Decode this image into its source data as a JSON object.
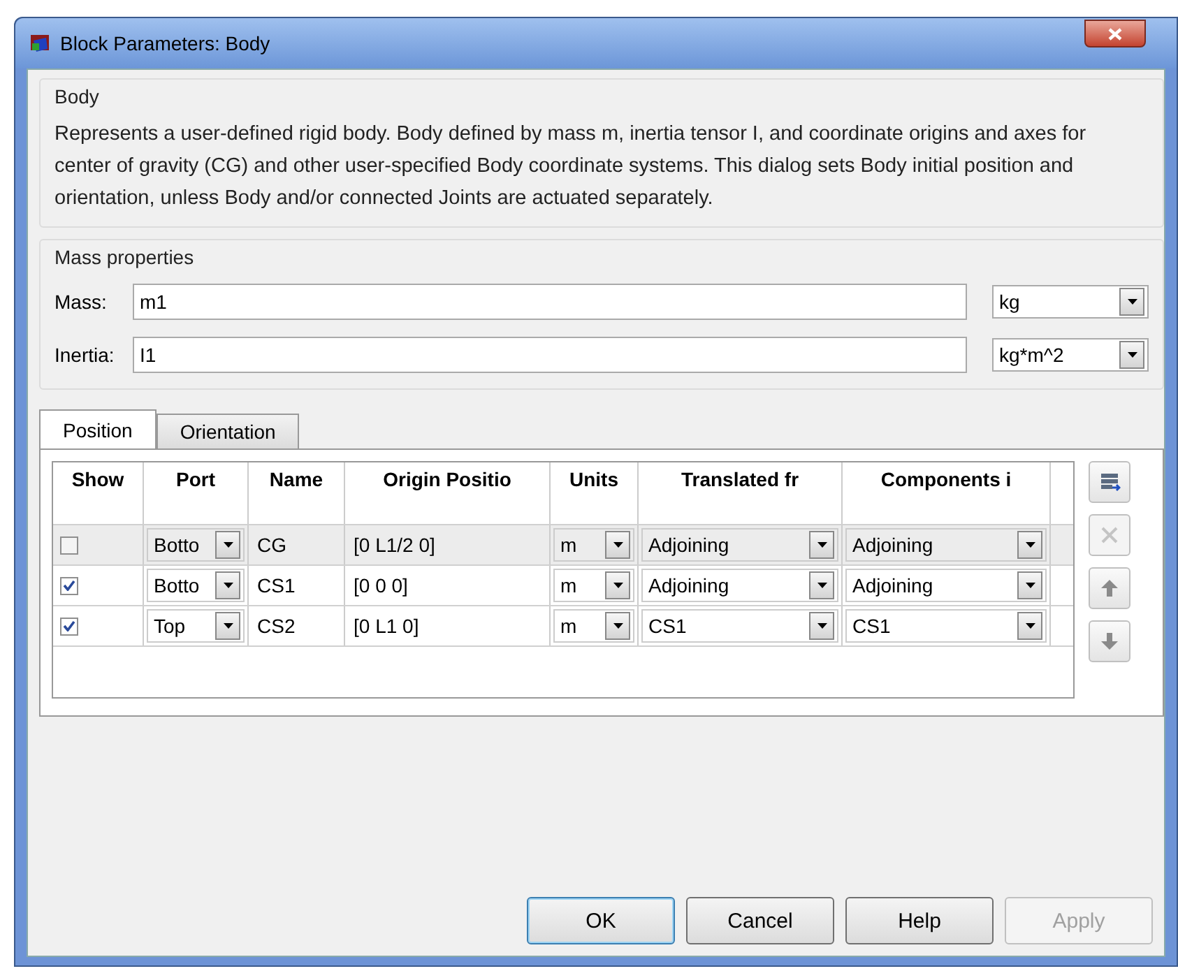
{
  "window": {
    "title": "Block Parameters: Body"
  },
  "description_group": {
    "title": "Body",
    "text": "Represents a user-defined rigid body. Body defined by mass m, inertia tensor I, and coordinate origins and axes for center of gravity (CG) and other user-specified Body coordinate systems. This dialog sets Body initial position and orientation, unless Body and/or connected Joints are actuated separately."
  },
  "mass_group": {
    "title": "Mass properties",
    "fields": [
      {
        "label": "Mass:",
        "value": "m1",
        "unit": "kg"
      },
      {
        "label": "Inertia:",
        "value": "I1",
        "unit": "kg*m^2"
      }
    ]
  },
  "tabs": [
    {
      "label": "Position",
      "selected": true
    },
    {
      "label": "Orientation",
      "selected": false
    }
  ],
  "table": {
    "columns": [
      "Show",
      "Port",
      "Name",
      "Origin Positio",
      "Units",
      "Translated fr",
      "Components i"
    ],
    "rows": [
      {
        "show": false,
        "selected": true,
        "port_side": "Botto",
        "name": "CG",
        "origin": "[0 L1/2 0]",
        "units": "m",
        "translated": "Adjoining",
        "components": "Adjoining"
      },
      {
        "show": true,
        "selected": false,
        "port_side": "Botto",
        "name": "CS1",
        "origin": "[0 0 0]",
        "units": "m",
        "translated": "Adjoining",
        "components": "Adjoining"
      },
      {
        "show": true,
        "selected": false,
        "port_side": "Top",
        "name": "CS2",
        "origin": "[0 L1 0]",
        "units": "m",
        "translated": "CS1",
        "components": "CS1"
      }
    ]
  },
  "side_buttons": [
    {
      "kind": "add",
      "disabled": false
    },
    {
      "kind": "delete",
      "disabled": true
    },
    {
      "kind": "up",
      "disabled": false
    },
    {
      "kind": "down",
      "disabled": false
    }
  ],
  "buttons": [
    {
      "label": "OK",
      "default": true,
      "disabled": false
    },
    {
      "label": "Cancel",
      "default": false,
      "disabled": false
    },
    {
      "label": "Help",
      "default": false,
      "disabled": false
    },
    {
      "label": "Apply",
      "default": false,
      "disabled": true
    }
  ]
}
